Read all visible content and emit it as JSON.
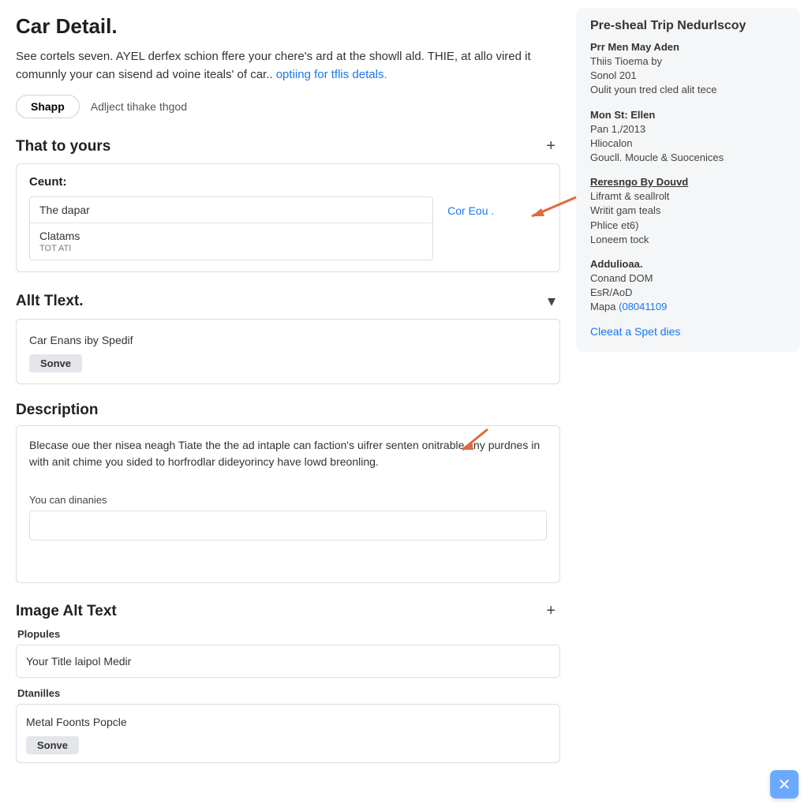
{
  "header": {
    "title": "Car Detail.",
    "intro_before_link": "See cortels seven. AYEL derfex schion ffere your chere's ard at the showll ald. THIE, at allo vired it comunnly your can sisend ad voine iteals' of car.. ",
    "intro_link": "optiing for tflis detals.",
    "shapp_btn": "Shapp",
    "ghost": "Adlject tihake thgod"
  },
  "section_yours": {
    "title": "That to yours",
    "toggle": "+",
    "count_label": "Ceunt:",
    "card1": "The dapar",
    "card2": "Clatams",
    "card2_sub": "TOT ATI",
    "inline_link": "Cor Eou ."
  },
  "section_alt": {
    "title": "Allt Tlext.",
    "toggle": "▾",
    "input_value": "Car Enans iby Spedif",
    "save": "Sonve"
  },
  "section_desc": {
    "title": "Description",
    "body": "Blecase oue ther nisea neagh Tiate the the ad intaple can faction's uifrer senten onitrable any purdnes in with anit chime you sided to horfrodlar dideyorincy have lowd breonling.",
    "sublabel": "You can dinanies"
  },
  "section_img_alt": {
    "title": "Image Alt Text",
    "toggle": "+",
    "group1_label": "Plopules",
    "group1_value": "Your Title laipol Medir",
    "group2_label": "Dtanilles",
    "group2_value": "Metal Foonts Popcle",
    "save": "Sonve"
  },
  "sidebar": {
    "title": "Pre-sheal Trip Nedurlscoy",
    "b1": {
      "head": "Prr Men May Aden",
      "l1": "Thiis Tioema by",
      "l2": "Sonol 201",
      "l3": "Oulit youn tred cled alit tece"
    },
    "b2": {
      "head": "Mon St: Ellen",
      "l1": "Pan 1,/2013",
      "l2": "Hliocalon",
      "l3": "Goucll. Moucle & Suocenices"
    },
    "b3": {
      "head": "Reresngo By Douvd",
      "l1": "Liframt & seallrolt",
      "l2": "Writit gam teals",
      "l3": "Phlice et6)",
      "l4": "Loneem tock"
    },
    "b4": {
      "head": "Addulioaa.",
      "l1": "Conand DOM",
      "l2": "EsR/AoD",
      "l3_pre": "Mapa ",
      "l3_link": "(08041109"
    },
    "cta": "Cleeat a Spet dies"
  }
}
